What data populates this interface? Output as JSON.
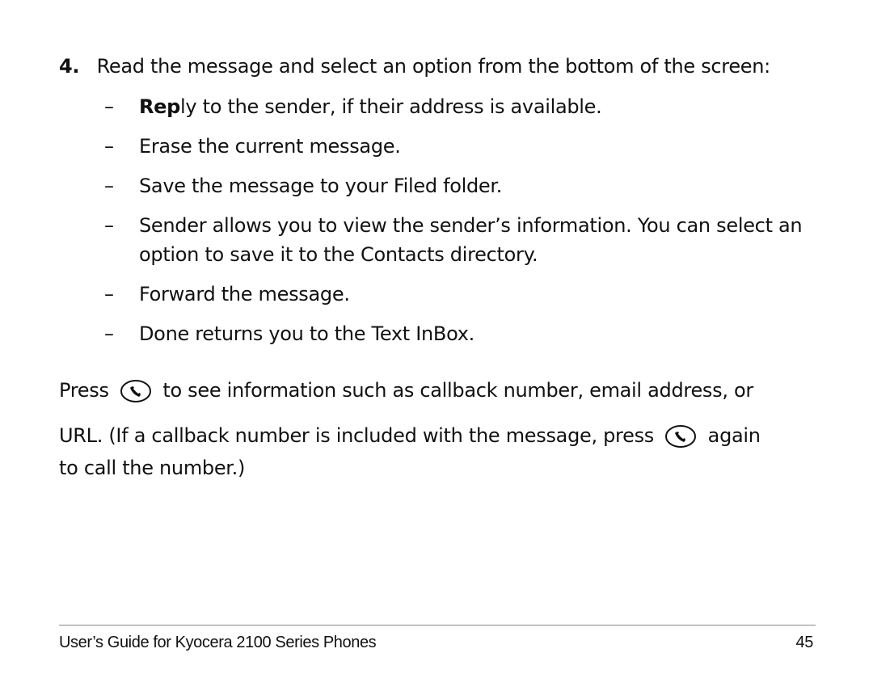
{
  "step": {
    "number": "4.",
    "text": "Read the message and select an option from the bottom of the screen:"
  },
  "options": [
    {
      "bold": "Rep",
      "rest": "ly to the sender, if their address is available."
    },
    {
      "bold": "",
      "rest": "Erase the current message."
    },
    {
      "bold": "",
      "rest": "Save the message to your Filed folder."
    },
    {
      "bold": "",
      "rest": "Sender allows you to view the sender’s information. You can select an",
      "rest2": "option to save it to the Contacts directory."
    },
    {
      "bold": "",
      "rest": "Forward the message."
    },
    {
      "bold": "",
      "rest": "Done returns you to the Text InBox."
    }
  ],
  "dash": "–",
  "para": {
    "line1_a": "Press",
    "line1_b": "to see information such as callback number, email address, or",
    "line2_a": "URL. (If a callback number is included with the message, press",
    "line2_b": "again",
    "line3": "to call the number.)",
    "icon": "send-call-key-icon"
  },
  "footer": {
    "title": "User’s Guide for Kyocera 2100 Series Phones",
    "page": "45"
  }
}
